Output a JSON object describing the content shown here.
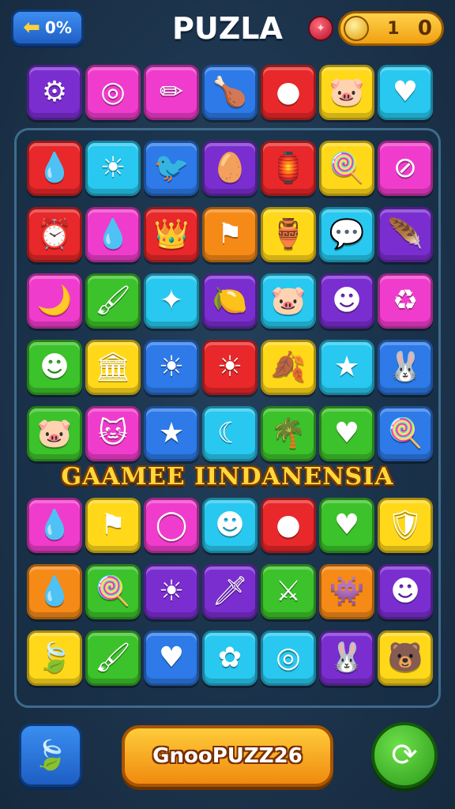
{
  "header": {
    "back_arrow": "⬅",
    "progress": "0%",
    "title": "PUZLA",
    "coins_value": "1",
    "coins_value2": "0"
  },
  "banner": "GAAMEE IINDANENSIA",
  "footer": {
    "play_label": "GnooPUZZ26"
  },
  "colors": {
    "red": "#e8282a",
    "orange": "#f68a16",
    "yellow": "#ffd81a",
    "green": "#3cc22a",
    "cyan": "#28c8f0",
    "blue": "#2d7ae8",
    "purple": "#7a2ed0",
    "pink": "#f03ccc"
  },
  "top_row": [
    {
      "name": "gear-icon",
      "color": "purple",
      "glyph": "⚙"
    },
    {
      "name": "spiral-icon",
      "color": "pink",
      "glyph": "◎"
    },
    {
      "name": "pencil-icon",
      "color": "pink",
      "glyph": "✏"
    },
    {
      "name": "drumstick-icon",
      "color": "blue",
      "glyph": "🍗"
    },
    {
      "name": "green-orb-icon",
      "color": "red",
      "glyph": "●"
    },
    {
      "name": "pig-face-icon",
      "color": "yellow",
      "glyph": "🐷"
    },
    {
      "name": "heart-icon",
      "color": "cyan",
      "glyph": "♥"
    }
  ],
  "grid_top": [
    [
      {
        "name": "drop-icon",
        "color": "red",
        "glyph": "💧"
      },
      {
        "name": "sun-icon",
        "color": "cyan",
        "glyph": "☀"
      },
      {
        "name": "bird-icon",
        "color": "blue",
        "glyph": "🐦"
      },
      {
        "name": "egg-icon",
        "color": "purple",
        "glyph": "🥚"
      },
      {
        "name": "lantern-icon",
        "color": "red",
        "glyph": "🏮"
      },
      {
        "name": "lollipop-icon",
        "color": "yellow",
        "glyph": "🍭"
      },
      {
        "name": "circle-slash-icon",
        "color": "pink",
        "glyph": "⊘"
      }
    ],
    [
      {
        "name": "clock-icon",
        "color": "red",
        "glyph": "⏰"
      },
      {
        "name": "drop-icon",
        "color": "pink",
        "glyph": "💧"
      },
      {
        "name": "crown-icon",
        "color": "red",
        "glyph": "👑"
      },
      {
        "name": "flag-icon",
        "color": "orange",
        "glyph": "⚑"
      },
      {
        "name": "jar-icon",
        "color": "yellow",
        "glyph": "🏺"
      },
      {
        "name": "bubble-icon",
        "color": "cyan",
        "glyph": "💬"
      },
      {
        "name": "feather-icon",
        "color": "purple",
        "glyph": "🪶"
      }
    ],
    [
      {
        "name": "moon-icon",
        "color": "pink",
        "glyph": "🌙"
      },
      {
        "name": "brush-icon",
        "color": "green",
        "glyph": "🖌"
      },
      {
        "name": "star-icon",
        "color": "cyan",
        "glyph": "✦"
      },
      {
        "name": "lemon-icon",
        "color": "purple",
        "glyph": "🍋"
      },
      {
        "name": "pig-face-icon",
        "color": "cyan",
        "glyph": "🐷"
      },
      {
        "name": "smiley-icon",
        "color": "purple",
        "glyph": "☻"
      },
      {
        "name": "recycle-icon",
        "color": "pink",
        "glyph": "♻"
      }
    ],
    [
      {
        "name": "smiley-icon",
        "color": "green",
        "glyph": "☻"
      },
      {
        "name": "temple-icon",
        "color": "yellow",
        "glyph": "🏛"
      },
      {
        "name": "sun-icon",
        "color": "blue",
        "glyph": "☀"
      },
      {
        "name": "sun-icon",
        "color": "red",
        "glyph": "☀"
      },
      {
        "name": "leaf-icon",
        "color": "yellow",
        "glyph": "🍂"
      },
      {
        "name": "star-icon",
        "color": "cyan",
        "glyph": "★"
      },
      {
        "name": "bunny-icon",
        "color": "blue",
        "glyph": "🐰"
      }
    ],
    [
      {
        "name": "pig-face-icon",
        "color": "green",
        "glyph": "🐷"
      },
      {
        "name": "cat-face-icon",
        "color": "pink",
        "glyph": "🐱"
      },
      {
        "name": "star-icon",
        "color": "blue",
        "glyph": "★"
      },
      {
        "name": "moon-icon",
        "color": "cyan",
        "glyph": "☾"
      },
      {
        "name": "palm-tree-icon",
        "color": "green",
        "glyph": "🌴"
      },
      {
        "name": "heart-icon",
        "color": "green",
        "glyph": "♥"
      },
      {
        "name": "lollipop-icon",
        "color": "blue",
        "glyph": "🍭"
      }
    ]
  ],
  "grid_bottom": [
    [
      {
        "name": "drop-icon",
        "color": "pink",
        "glyph": "💧"
      },
      {
        "name": "flag-icon",
        "color": "yellow",
        "glyph": "⚑"
      },
      {
        "name": "ring-icon",
        "color": "pink",
        "glyph": "◯"
      },
      {
        "name": "smiley-icon",
        "color": "cyan",
        "glyph": "☻"
      },
      {
        "name": "plum-icon",
        "color": "red",
        "glyph": "●"
      },
      {
        "name": "heart-icon",
        "color": "green",
        "glyph": "♥"
      },
      {
        "name": "shield-icon",
        "color": "yellow",
        "glyph": "🛡"
      }
    ],
    [
      {
        "name": "drop-icon",
        "color": "orange",
        "glyph": "💧"
      },
      {
        "name": "lollipop-icon",
        "color": "green",
        "glyph": "🍭"
      },
      {
        "name": "sun-icon",
        "color": "purple",
        "glyph": "☀"
      },
      {
        "name": "sword-icon",
        "color": "purple",
        "glyph": "🗡"
      },
      {
        "name": "crossed-tools-icon",
        "color": "green",
        "glyph": "⚔"
      },
      {
        "name": "monster-icon",
        "color": "orange",
        "glyph": "👾"
      },
      {
        "name": "smiley-icon",
        "color": "purple",
        "glyph": "☻"
      }
    ],
    [
      {
        "name": "leaf-icon",
        "color": "yellow",
        "glyph": "🍃"
      },
      {
        "name": "brush-icon",
        "color": "green",
        "glyph": "🖌"
      },
      {
        "name": "heart-icon",
        "color": "blue",
        "glyph": "♥"
      },
      {
        "name": "flower-icon",
        "color": "cyan",
        "glyph": "✿"
      },
      {
        "name": "spiral-icon",
        "color": "cyan",
        "glyph": "◎"
      },
      {
        "name": "bunny-icon",
        "color": "purple",
        "glyph": "🐰"
      },
      {
        "name": "bear-face-icon",
        "color": "yellow",
        "glyph": "🐻"
      }
    ]
  ]
}
